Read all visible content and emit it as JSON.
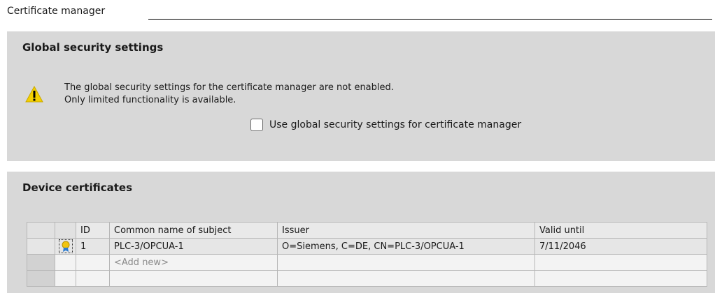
{
  "header": {
    "title": "Certificate manager"
  },
  "global_security": {
    "title": "Global security settings",
    "warning_line1": "The global security settings for the certificate manager are not enabled.",
    "warning_line2": "Only limited functionality is available.",
    "checkbox_label": "Use global security settings for certificate manager",
    "checkbox_checked": false,
    "warning_icon": "warning-triangle-icon"
  },
  "device_certificates": {
    "title": "Device certificates",
    "columns": [
      "ID",
      "Common name of subject",
      "Issuer",
      "Valid until"
    ],
    "rows": [
      {
        "id": "1",
        "subject": "PLC-3/OPCUA-1",
        "issuer": "O=Siemens, C=DE, CN=PLC-3/OPCUA-1",
        "valid_until": "7/11/2046",
        "icon": "certificate-icon"
      }
    ],
    "add_new": "<Add new>"
  }
}
